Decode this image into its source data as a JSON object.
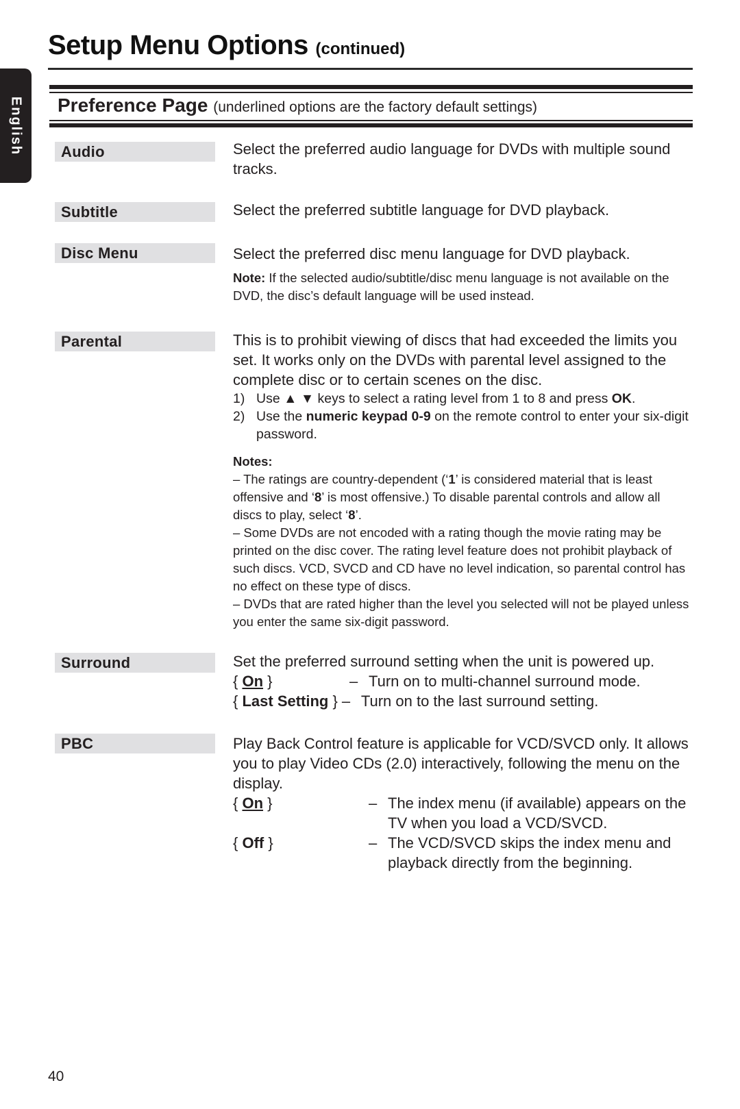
{
  "header": {
    "title": "Setup Menu Options",
    "title_suffix": "(continued)",
    "language_tab": "English"
  },
  "section": {
    "title": "Preference Page",
    "subtitle": "(underlined options are the factory default settings)"
  },
  "options": {
    "audio": {
      "label": "Audio",
      "description": "Select the preferred audio language for DVDs with multiple sound tracks."
    },
    "subtitle": {
      "label": "Subtitle",
      "description": "Select the preferred subtitle language for DVD playback."
    },
    "disc_menu": {
      "label": "Disc Menu",
      "description": "Select the preferred disc menu language for DVD playback.",
      "note_label": "Note:",
      "note_text": " If the selected audio/subtitle/disc menu language is not available on the DVD, the disc’s default language will be used instead."
    },
    "parental": {
      "label": "Parental",
      "description": "This is to prohibit viewing of discs that had exceeded the limits you set.  It works only on the DVDs with parental level assigned to the complete disc or to certain scenes on the disc.",
      "steps": [
        {
          "num": "1)",
          "pre": "Use ▲ ▼ keys to select a rating level from 1 to 8 and press ",
          "bold": "OK",
          "post": "."
        },
        {
          "num": "2)",
          "pre": "Use the ",
          "bold": "numeric keypad 0-9",
          "post": " on the remote control to enter your six-digit password."
        }
      ],
      "notes_label": "Notes:",
      "notes": {
        "n1_a": "–  The ratings are country-dependent (‘",
        "n1_b": "1",
        "n1_c": "’ is considered material that is least offensive and ‘",
        "n1_d": "8",
        "n1_e": "’ is most offensive.)  To disable parental controls and allow all discs to play, select ‘",
        "n1_f": "8",
        "n1_g": "’.",
        "n2": "–  Some DVDs are not encoded with a rating though the movie rating may be printed on the disc cover.  The rating level feature does not prohibit playback of such discs.  VCD, SVCD and CD have no level indication, so parental control has no effect on these type of discs.",
        "n3": "–  DVDs that are rated higher than the level you selected will not be played unless you enter the same six-digit password."
      }
    },
    "surround": {
      "label": "Surround",
      "description": "Set the preferred surround setting when the unit is powered up.",
      "choices": [
        {
          "name": "On",
          "default": true,
          "dash": "–",
          "text": "Turn on to multi-channel surround mode."
        },
        {
          "name": "Last Setting",
          "default": false,
          "dash": "–",
          "text": "Turn on to the last surround setting."
        }
      ]
    },
    "pbc": {
      "label": "PBC",
      "description": "Play Back Control feature is applicable for VCD/SVCD only.  It allows you to play Video CDs (2.0) interactively, following the menu on the display.",
      "choices": [
        {
          "name": "On",
          "default": true,
          "dash": "–",
          "text": "The index menu (if available) appears on the TV when you load a VCD/SVCD."
        },
        {
          "name": "Off",
          "default": false,
          "dash": "–",
          "text": "The VCD/SVCD skips the index menu and playback directly from the beginning."
        }
      ]
    }
  },
  "footer": {
    "page_number": "40"
  }
}
